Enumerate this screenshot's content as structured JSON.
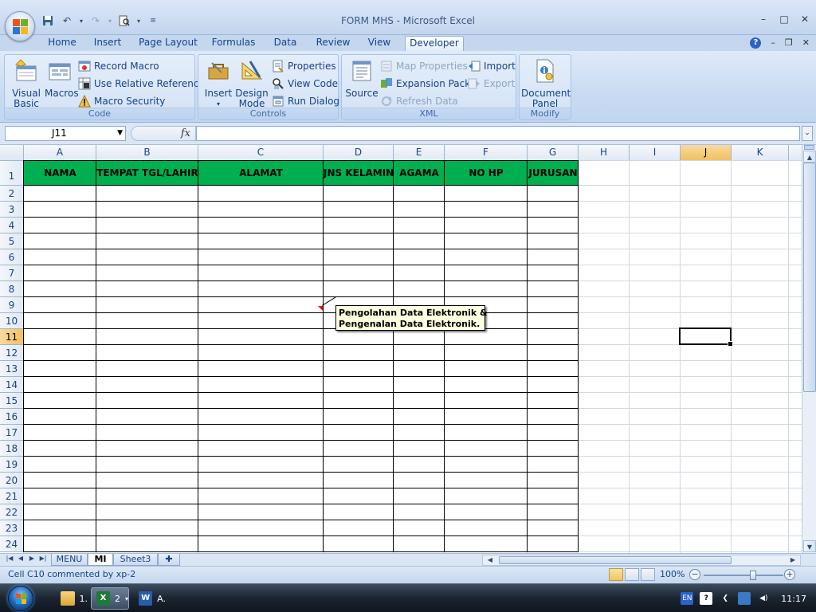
{
  "window": {
    "title": "FORM MHS - Microsoft Excel",
    "controls": [
      "–",
      "□",
      "✕"
    ]
  },
  "ribbon_tabs": [
    {
      "label": "Home",
      "active": false
    },
    {
      "label": "Insert",
      "active": false
    },
    {
      "label": "Page Layout",
      "active": false
    },
    {
      "label": "Formulas",
      "active": false
    },
    {
      "label": "Data",
      "active": false
    },
    {
      "label": "Review",
      "active": false
    },
    {
      "label": "View",
      "active": false
    },
    {
      "label": "Developer",
      "active": true
    }
  ],
  "ribbon": {
    "code": {
      "label": "Code",
      "visual_basic": [
        "Visual",
        "Basic"
      ],
      "macros": "Macros",
      "record_macro": "Record Macro",
      "relative_refs": "Use Relative References",
      "macro_security": "Macro Security"
    },
    "controls": {
      "label": "Controls",
      "insert": "Insert",
      "design_mode": [
        "Design",
        "Mode"
      ],
      "properties": "Properties",
      "view_code": "View Code",
      "run_dialog": "Run Dialog"
    },
    "xml": {
      "label": "XML",
      "source": "Source",
      "map_properties": "Map Properties",
      "expansion_packs": "Expansion Packs",
      "refresh_data": "Refresh Data",
      "import": "Import",
      "export": "Export"
    },
    "modify": {
      "label": "Modify",
      "document_panel": [
        "Document",
        "Panel"
      ]
    }
  },
  "formula_bar": {
    "name_box": "J11",
    "fx": "fx",
    "formula": ""
  },
  "columns": [
    "A",
    "B",
    "C",
    "D",
    "E",
    "F",
    "G",
    "H",
    "I",
    "J",
    "K"
  ],
  "rows": [
    "1",
    "2",
    "3",
    "4",
    "5",
    "6",
    "7",
    "8",
    "9",
    "10",
    "11",
    "12",
    "13",
    "14",
    "15",
    "16",
    "17",
    "18",
    "19",
    "20",
    "21",
    "22",
    "23",
    "24"
  ],
  "active_column": "J",
  "active_row": "11",
  "table_headers": [
    "NAMA",
    "TEMPAT TGL/LAHIR",
    "ALAMAT",
    "JNS KELAMIN",
    "AGAMA",
    "NO HP",
    "JURUSAN"
  ],
  "header_color": "#00b050",
  "comment": {
    "line1": "Pengolahan Data Elektronik &",
    "line2": "Pengenalan Data Elektronik."
  },
  "sheets": [
    {
      "label": "MENU",
      "active": false
    },
    {
      "label": "MI",
      "active": true
    },
    {
      "label": "Sheet3",
      "active": false
    }
  ],
  "status": {
    "text": "Cell C10 commented by xp-2",
    "zoom": "100%",
    "zoom_level_percent": 100
  },
  "taskbar": {
    "items": [
      {
        "label": "1.",
        "icon": "explorer-icon"
      },
      {
        "label": "2",
        "icon": "excel-icon",
        "active": true
      },
      {
        "label": "A.",
        "icon": "word-icon"
      }
    ],
    "language": "EN",
    "clock": "11:17"
  }
}
